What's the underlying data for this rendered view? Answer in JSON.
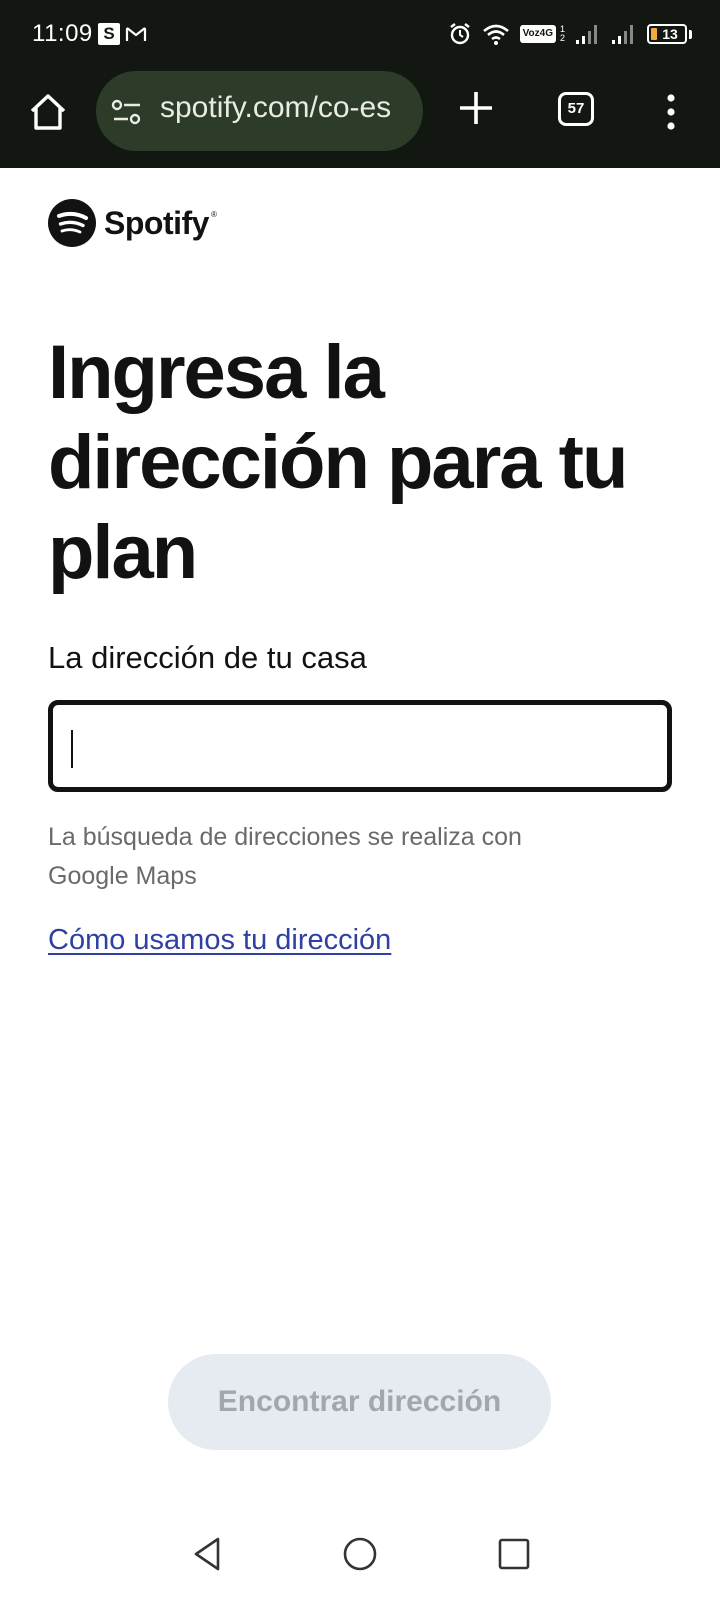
{
  "status_bar": {
    "time": "11:09",
    "app_icon_s": "S",
    "volte_label": "Voz4G",
    "sim_fraction_top": "1",
    "sim_fraction_bottom": "2",
    "battery_level": "13"
  },
  "browser": {
    "url": "spotify.com/co-es",
    "tab_count": "57"
  },
  "brand": {
    "name": "Spotify",
    "color": "#121212"
  },
  "page": {
    "title": "Ingresa la dirección para tu plan",
    "field_label": "La dirección de tu casa",
    "address_value": "",
    "helper_text": "La búsqueda de direcciones se realiza con Google Maps",
    "link_text": "Cómo usamos tu dirección",
    "find_button_label": "Encontrar dirección"
  },
  "colors": {
    "toolbar_bg": "#131711",
    "url_pill_bg": "#2d3b29",
    "link": "#2f3fa3",
    "button_disabled_bg": "#e6eaf1",
    "button_disabled_text": "#a3a7ad"
  }
}
